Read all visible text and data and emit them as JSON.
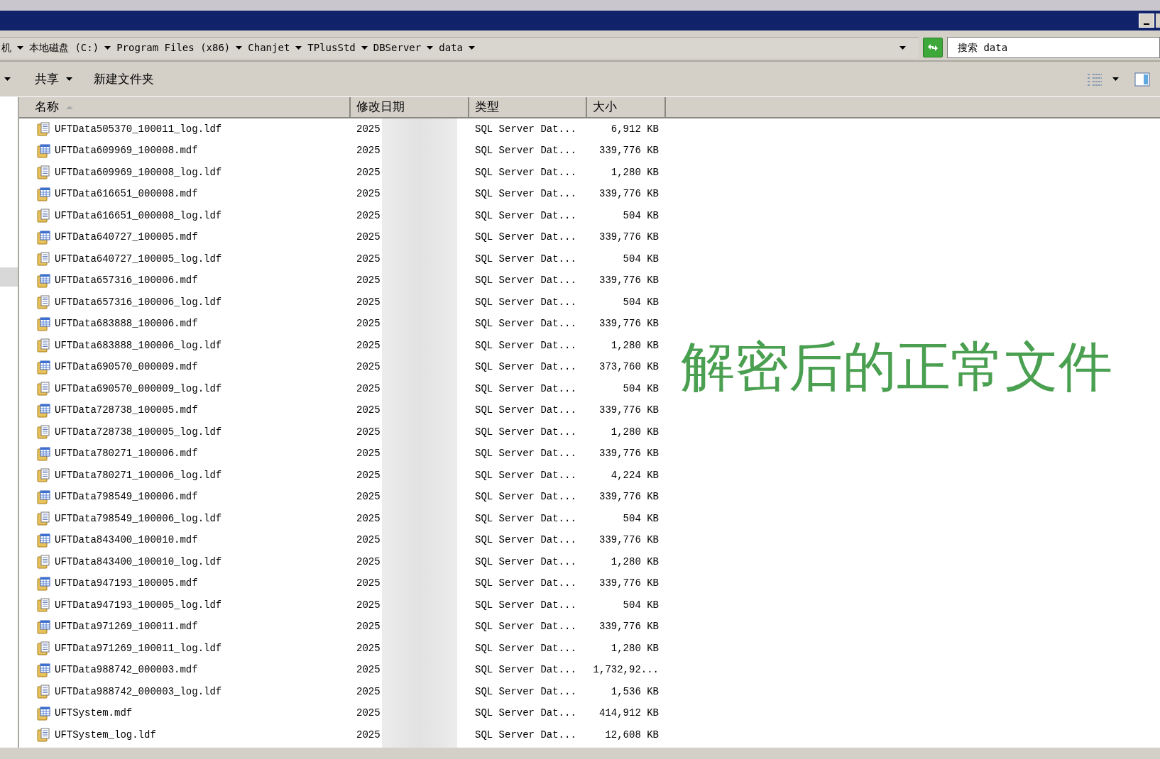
{
  "breadcrumbs": [
    {
      "label": "机"
    },
    {
      "label": "本地磁盘 (C:)"
    },
    {
      "label": "Program Files (x86)"
    },
    {
      "label": "Chanjet"
    },
    {
      "label": "TPlusStd"
    },
    {
      "label": "DBServer"
    },
    {
      "label": "data"
    }
  ],
  "search": {
    "placeholder": "搜索 data"
  },
  "toolbar": [
    "共享",
    "新建文件夹"
  ],
  "columns": [
    {
      "label": "名称",
      "sorted": true
    },
    {
      "label": "修改日期",
      "sorted": false
    },
    {
      "label": "类型",
      "sorted": false
    },
    {
      "label": "大小",
      "sorted": false
    }
  ],
  "rows": [
    {
      "kind": "ldf",
      "name": "UFTData505370_100011_log.ldf",
      "date": "2025",
      "type": "SQL Server Dat...",
      "size": "6,912 KB"
    },
    {
      "kind": "mdf",
      "name": "UFTData609969_100008.mdf",
      "date": "2025",
      "type": "SQL Server Dat...",
      "size": "339,776 KB"
    },
    {
      "kind": "ldf",
      "name": "UFTData609969_100008_log.ldf",
      "date": "2025",
      "type": "SQL Server Dat...",
      "size": "1,280 KB"
    },
    {
      "kind": "mdf",
      "name": "UFTData616651_000008.mdf",
      "date": "2025",
      "type": "SQL Server Dat...",
      "size": "339,776 KB"
    },
    {
      "kind": "ldf",
      "name": "UFTData616651_000008_log.ldf",
      "date": "2025",
      "type": "SQL Server Dat...",
      "size": "504 KB"
    },
    {
      "kind": "mdf",
      "name": "UFTData640727_100005.mdf",
      "date": "2025",
      "type": "SQL Server Dat...",
      "size": "339,776 KB"
    },
    {
      "kind": "ldf",
      "name": "UFTData640727_100005_log.ldf",
      "date": "2025",
      "type": "SQL Server Dat...",
      "size": "504 KB"
    },
    {
      "kind": "mdf",
      "name": "UFTData657316_100006.mdf",
      "date": "2025",
      "type": "SQL Server Dat...",
      "size": "339,776 KB"
    },
    {
      "kind": "ldf",
      "name": "UFTData657316_100006_log.ldf",
      "date": "2025",
      "type": "SQL Server Dat...",
      "size": "504 KB"
    },
    {
      "kind": "mdf",
      "name": "UFTData683888_100006.mdf",
      "date": "2025",
      "type": "SQL Server Dat...",
      "size": "339,776 KB"
    },
    {
      "kind": "ldf",
      "name": "UFTData683888_100006_log.ldf",
      "date": "2025",
      "type": "SQL Server Dat...",
      "size": "1,280 KB"
    },
    {
      "kind": "mdf",
      "name": "UFTData690570_000009.mdf",
      "date": "2025",
      "type": "SQL Server Dat...",
      "size": "373,760 KB"
    },
    {
      "kind": "ldf",
      "name": "UFTData690570_000009_log.ldf",
      "date": "2025",
      "type": "SQL Server Dat...",
      "size": "504 KB"
    },
    {
      "kind": "mdf",
      "name": "UFTData728738_100005.mdf",
      "date": "2025",
      "type": "SQL Server Dat...",
      "size": "339,776 KB"
    },
    {
      "kind": "ldf",
      "name": "UFTData728738_100005_log.ldf",
      "date": "2025",
      "type": "SQL Server Dat...",
      "size": "1,280 KB"
    },
    {
      "kind": "mdf",
      "name": "UFTData780271_100006.mdf",
      "date": "2025",
      "type": "SQL Server Dat...",
      "size": "339,776 KB"
    },
    {
      "kind": "ldf",
      "name": "UFTData780271_100006_log.ldf",
      "date": "2025",
      "type": "SQL Server Dat...",
      "size": "4,224 KB"
    },
    {
      "kind": "mdf",
      "name": "UFTData798549_100006.mdf",
      "date": "2025",
      "type": "SQL Server Dat...",
      "size": "339,776 KB"
    },
    {
      "kind": "ldf",
      "name": "UFTData798549_100006_log.ldf",
      "date": "2025",
      "type": "SQL Server Dat...",
      "size": "504 KB"
    },
    {
      "kind": "mdf",
      "name": "UFTData843400_100010.mdf",
      "date": "2025",
      "type": "SQL Server Dat...",
      "size": "339,776 KB"
    },
    {
      "kind": "ldf",
      "name": "UFTData843400_100010_log.ldf",
      "date": "2025",
      "type": "SQL Server Dat...",
      "size": "1,280 KB"
    },
    {
      "kind": "mdf",
      "name": "UFTData947193_100005.mdf",
      "date": "2025",
      "type": "SQL Server Dat...",
      "size": "339,776 KB"
    },
    {
      "kind": "ldf",
      "name": "UFTData947193_100005_log.ldf",
      "date": "2025",
      "type": "SQL Server Dat...",
      "size": "504 KB"
    },
    {
      "kind": "mdf",
      "name": "UFTData971269_100011.mdf",
      "date": "2025",
      "type": "SQL Server Dat...",
      "size": "339,776 KB"
    },
    {
      "kind": "ldf",
      "name": "UFTData971269_100011_log.ldf",
      "date": "2025",
      "type": "SQL Server Dat...",
      "size": "1,280 KB"
    },
    {
      "kind": "mdf",
      "name": "UFTData988742_000003.mdf",
      "date": "2025",
      "type": "SQL Server Dat...",
      "size": "1,732,92..."
    },
    {
      "kind": "ldf",
      "name": "UFTData988742_000003_log.ldf",
      "date": "2025",
      "type": "SQL Server Dat...",
      "size": "1,536 KB"
    },
    {
      "kind": "mdf",
      "name": "UFTSystem.mdf",
      "date": "2025",
      "type": "SQL Server Dat...",
      "size": "414,912 KB"
    },
    {
      "kind": "ldf",
      "name": "UFTSystem_log.ldf",
      "date": "2025",
      "type": "SQL Server Dat...",
      "size": "12,608 KB"
    }
  ],
  "annotation": "解密后的正常文件"
}
